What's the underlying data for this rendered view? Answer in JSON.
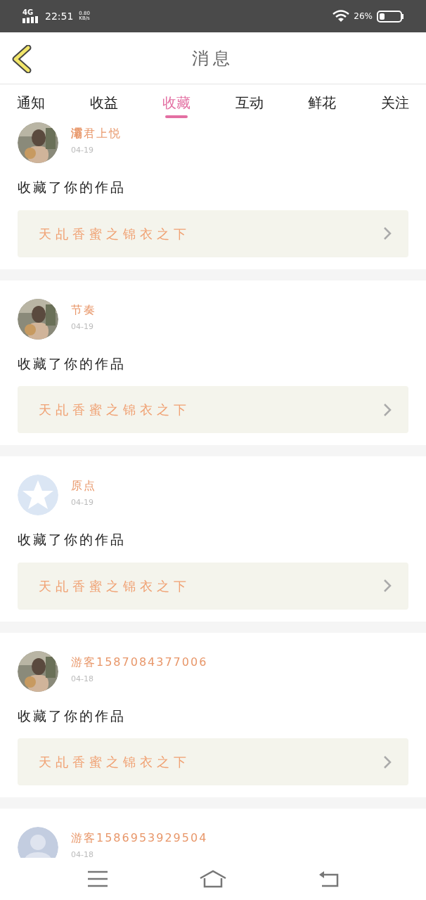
{
  "status_bar": {
    "network": "4G",
    "time": "22:51",
    "speed_value": "0.80",
    "speed_unit": "KB/s",
    "battery_text": "26%"
  },
  "header": {
    "title": "消息"
  },
  "tabs": [
    {
      "label": "通知",
      "selected": false
    },
    {
      "label": "收益",
      "selected": false
    },
    {
      "label": "收藏",
      "selected": true
    },
    {
      "label": "互动",
      "selected": false
    },
    {
      "label": "鲜花",
      "selected": false
    },
    {
      "label": "关注",
      "selected": false
    }
  ],
  "messages": [
    {
      "name": "**灞**君上悦",
      "date": "04-19",
      "action": "收藏了你的作品",
      "work": "天乩香蜜之锦衣之下"
    },
    {
      "name": "节奏",
      "date": "04-19",
      "action": "收藏了你的作品",
      "work": "天乩香蜜之锦衣之下"
    },
    {
      "avatar": {
        "kind": "star"
      },
      "name": "原点",
      "date": "04-19",
      "action": "收藏了你的作品",
      "work": "天乩香蜜之锦衣之下"
    },
    {
      "name": "游客1587084377006",
      "date": "04-18",
      "action": "收藏了你的作品",
      "work": "天乩香蜜之锦衣之下"
    },
    {
      "avatar": {
        "kind": "default"
      },
      "name": "游客1586953929504",
      "date": "04-18"
    }
  ]
}
